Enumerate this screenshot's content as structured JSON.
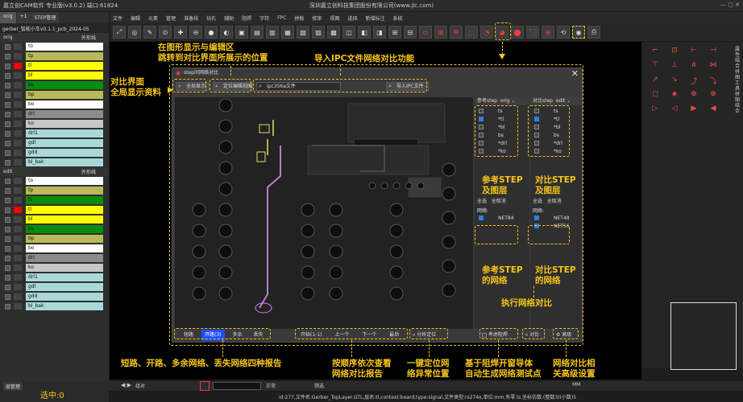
{
  "titlebar": {
    "app": "嘉立创CAM软件 专业版(v3.0.2) 端口:61824",
    "company": "深圳嘉立创科技集团股份有限公司(www.jlc.com)"
  },
  "menu": [
    "文件",
    "编辑",
    "元素",
    "管理",
    "准备线",
    "钻孔",
    "辅助",
    "阻焊",
    "字符",
    "FPC",
    "拼板",
    "修审",
    "视图",
    "选择",
    "新增标注",
    "系统"
  ],
  "left": {
    "tabs": [
      "orig",
      "+1",
      "STEP管理"
    ],
    "file": "gerber_智能小车v0.1.1_pcb_2024-05",
    "orig_header": {
      "name": "orig",
      "right": "外形线"
    },
    "edit_header": {
      "name": "edit",
      "right": "外形线"
    },
    "orig_layers": [
      {
        "name": "to",
        "color": "#ffffff"
      },
      {
        "name": "tp",
        "color": "#b9b95a"
      },
      {
        "name": "tl",
        "color": "#ffff00",
        "mark": "#ff0000"
      },
      {
        "name": "bl",
        "color": "#ffff00"
      },
      {
        "name": "bs",
        "color": "#0a8c0a"
      },
      {
        "name": "bp",
        "color": "#b9b95a"
      },
      {
        "name": "bo",
        "color": "#ffffff"
      },
      {
        "name": "drl",
        "color": "#8c8c8c"
      },
      {
        "name": "ko",
        "color": "#c8c8c8"
      },
      {
        "name": "drl1",
        "color": "#a9d8d8"
      },
      {
        "name": "gdl",
        "color": "#a9d8d8"
      },
      {
        "name": "gdd",
        "color": "#a9d8d8"
      },
      {
        "name": "bl_bak",
        "color": "#a9d8d8"
      }
    ],
    "edit_layers": [
      {
        "name": "to",
        "color": "#ffffff"
      },
      {
        "name": "tp",
        "color": "#b9b95a"
      },
      {
        "name": "ts",
        "color": "#0a8c0a"
      },
      {
        "name": "tl",
        "color": "#ffff00",
        "mark": "#ff0000"
      },
      {
        "name": "bl",
        "color": "#ffff00"
      },
      {
        "name": "bs",
        "color": "#0a8c0a"
      },
      {
        "name": "bp",
        "color": "#b9b95a"
      },
      {
        "name": "bo",
        "color": "#ffffff"
      },
      {
        "name": "drl",
        "color": "#8c8c8c"
      },
      {
        "name": "ko",
        "color": "#c8c8c8"
      },
      {
        "name": "drl1",
        "color": "#a9d8d8"
      },
      {
        "name": "gdl",
        "color": "#a9d8d8"
      },
      {
        "name": "gdd",
        "color": "#a9d8d8"
      },
      {
        "name": "bl_bak",
        "color": "#a9d8d8"
      }
    ],
    "selected_label": "选中:0",
    "layer_manage": "层管理"
  },
  "dialog": {
    "title": "step间网络对比",
    "btn_full": "全局显示",
    "btn_locate": "定位编辑视图",
    "ipc_field": "ipc356a文件",
    "btn_import": "导入IPC文件",
    "ref_header": {
      "label": "参考step",
      "value": "orig"
    },
    "cmp_header": {
      "label": "对比step",
      "value": "edit"
    },
    "ref_layers": [
      {
        "name": "ts",
        "on": false
      },
      {
        "name": "*tl",
        "on": true
      },
      {
        "name": "*bl",
        "on": false
      },
      {
        "name": "bs",
        "on": false
      },
      {
        "name": "*drl",
        "on": false
      },
      {
        "name": "*ko",
        "on": false
      }
    ],
    "cmp_layers": [
      {
        "name": "ts",
        "on": false
      },
      {
        "name": "*tl",
        "on": true
      },
      {
        "name": "*bl",
        "on": false
      },
      {
        "name": "bs",
        "on": false
      },
      {
        "name": "*drl",
        "on": false
      },
      {
        "name": "*ko",
        "on": false
      }
    ],
    "select_all": "全选",
    "select_none": "全取消",
    "net_label": "网络:",
    "ref_nets": [
      {
        "name": "NET84",
        "on": true
      }
    ],
    "cmp_nets": [
      {
        "name": "NET48",
        "on": true
      },
      {
        "name": "NET56",
        "on": true
      }
    ],
    "report_tabs": [
      "短路",
      "开路(3)",
      "多余",
      "丢失"
    ],
    "report_active": 1,
    "nav": {
      "start": "开始(1-1)",
      "prev": "上一个",
      "next": "下一个",
      "last": "最后",
      "locate": "分析定位"
    },
    "consider_mask": "考虑阻焊",
    "compare": "对比",
    "advanced": "高级"
  },
  "bottom": {
    "zoom_sel": "组对",
    "mode_sel": "正常",
    "unit": "MM",
    "filter": "筛选",
    "status": "id:277,文件名:Gerber_TopLayer.GTL,层名:tl,context:board,type:signal,文件类型:rs274x,单位:mm,有零:lz,坐标仿数:(整数3)(小数)5"
  },
  "annotations": {
    "a1": "在图形显示与编辑区\n跳转到对比界面所展示的位置",
    "a2": "导入IPC文件网络对比功能",
    "a3": "对比界面\n全局显示资料",
    "a4": "参考STEP\n及图层",
    "a5": "对比STEP\n及图层",
    "a6": "参考STEP\n的网络",
    "a7": "对比STEP\n的网络",
    "a8": "执行网络对比",
    "a9": "短路、开路、多余网络、丢失网络四种报告",
    "a10": "按顺序依次查看\n网络对比报告",
    "a11": "一键定位网\n络异常位置",
    "a12": "基于阻焊开窗导体\n自动生成网络测试点",
    "a13": "网络对比相\n关高级设置"
  },
  "colors": {
    "accent": "#f5c518",
    "danger": "#ff3a3a",
    "active_tab": "#1e4fff",
    "check": "#2f7fe0"
  }
}
